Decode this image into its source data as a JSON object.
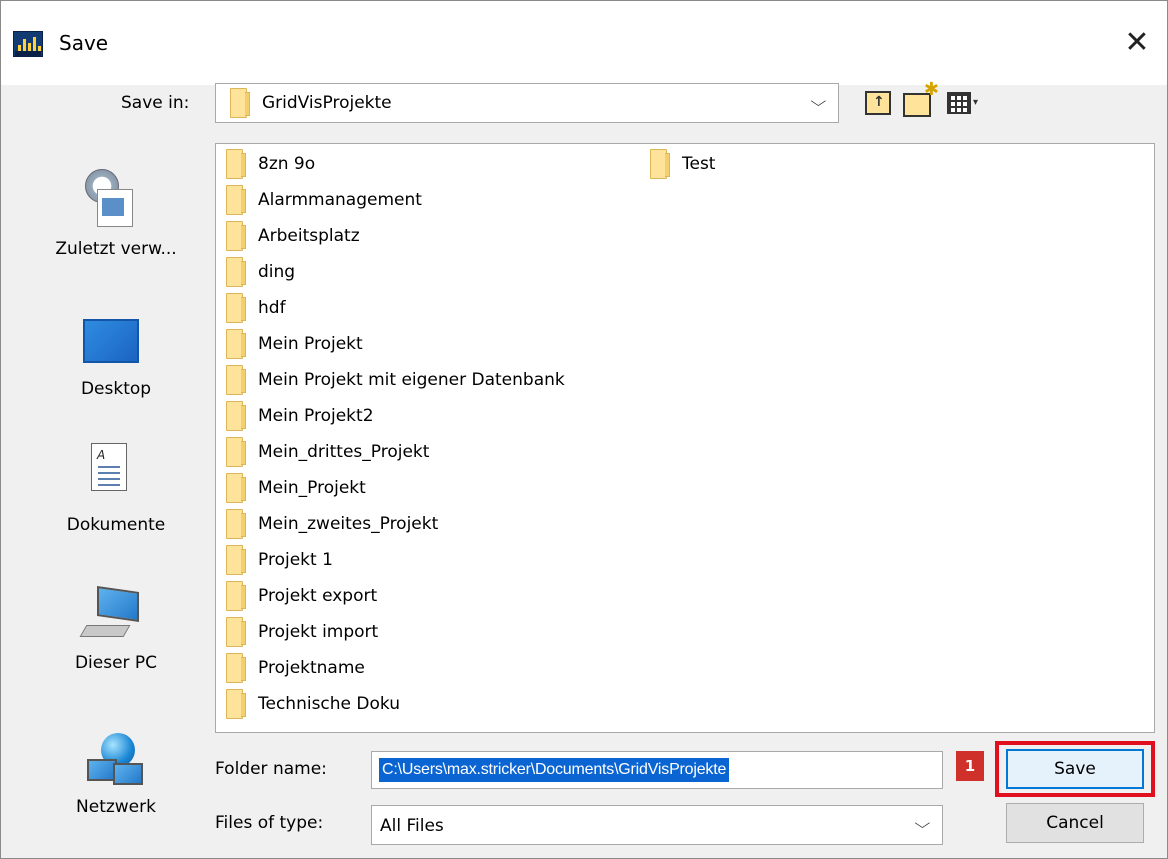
{
  "window": {
    "title": "Save",
    "close_symbol": "✕"
  },
  "save_in": {
    "label": "Save in:",
    "value": "GridVisProjekte",
    "arrow": "⌵"
  },
  "toolbar": {
    "up_glyph": "↑",
    "new_glyph": "✱",
    "view_glyph": "▾"
  },
  "sidebar": {
    "items": [
      {
        "label": "Zuletzt verw...",
        "icon": "recent-places-icon"
      },
      {
        "label": "Desktop",
        "icon": "desktop-icon"
      },
      {
        "label": "Dokumente",
        "icon": "documents-icon"
      },
      {
        "label": "Dieser PC",
        "icon": "this-pc-icon"
      },
      {
        "label": "Netzwerk",
        "icon": "network-icon"
      }
    ]
  },
  "files": [
    "8zn 9o",
    "Alarmmanagement",
    "Arbeitsplatz",
    "ding",
    "hdf",
    "Mein Projekt",
    "Mein Projekt mit eigener Datenbank",
    "Mein Projekt2",
    "Mein_drittes_Projekt",
    "Mein_Projekt",
    "Mein_zweites_Projekt",
    "Projekt 1",
    "Projekt export",
    "Projekt import",
    "Projektname",
    "Technische Doku",
    "Test"
  ],
  "form": {
    "folder_name_label": "Folder name:",
    "folder_name_value": "C:\\Users\\max.stricker\\Documents\\GridVisProjekte",
    "files_of_type_label": "Files of type:",
    "files_of_type_value": "All Files",
    "type_arrow": "⌵"
  },
  "buttons": {
    "save": "Save",
    "cancel": "Cancel"
  },
  "annotation": {
    "badge": "1",
    "color": "#e0101e"
  }
}
